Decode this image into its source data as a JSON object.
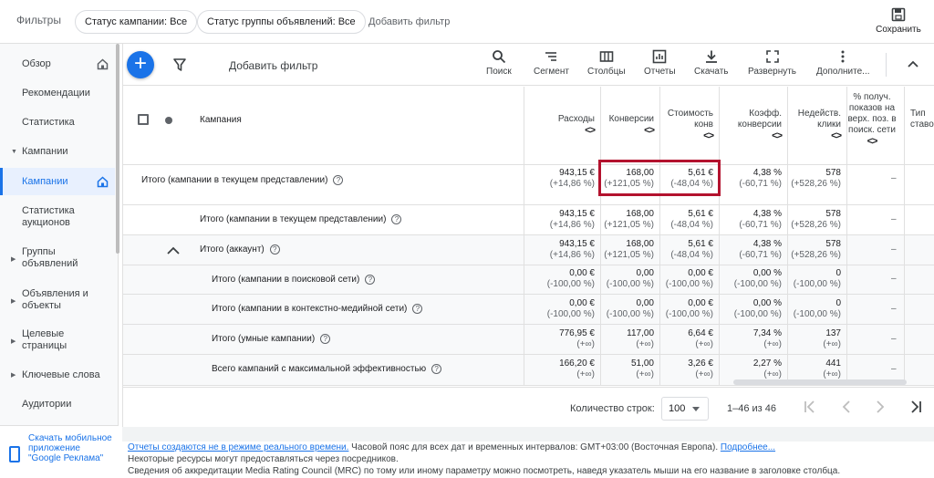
{
  "topbar": {
    "title": "Фильтры",
    "chips": [
      "Статус кампании: Все",
      "Статус группы объявлений: Все"
    ],
    "add_filter": "Добавить фильтр",
    "save_label": "Сохранить"
  },
  "sidebar": {
    "items": [
      {
        "label": "Обзор"
      },
      {
        "label": "Рекомендации"
      },
      {
        "label": "Статистика"
      },
      {
        "label": "Кампании"
      },
      {
        "label": "Кампании"
      },
      {
        "label": "Статистика аукционов"
      },
      {
        "label": "Группы объявлений"
      },
      {
        "label": "Объявления и объекты"
      },
      {
        "label": "Целевые страницы"
      },
      {
        "label": "Ключевые слова"
      },
      {
        "label": "Аудитории"
      }
    ],
    "app_promo": "Скачать мобильное приложение \"Google Реклама\""
  },
  "toolbar": {
    "add_filter": "Добавить фильтр",
    "tools": [
      "Поиск",
      "Сегмент",
      "Столбцы",
      "Отчеты",
      "Скачать",
      "Развернуть",
      "Дополните..."
    ]
  },
  "table": {
    "campaign_header": "Кампания",
    "columns": [
      "Расходы",
      "Конверсии",
      "Стоимость конв",
      "Коэфф. конверсии",
      "Недейств. клики",
      "% получ. показов на верх. поз. в поиск. сети",
      "Тип ставо"
    ],
    "rows": [
      {
        "label": "Итого (кампании в текущем представлении)",
        "values": [
          [
            "943,15 €",
            "(+14,86 %)"
          ],
          [
            "168,00",
            "(+121,05 %)"
          ],
          [
            "5,61 €",
            "(-48,04 %)"
          ],
          [
            "4,38 %",
            "(-60,71 %)"
          ],
          [
            "578",
            "(+528,26 %)"
          ]
        ],
        "dash": "–"
      },
      {
        "label": "Итого (кампании в текущем представлении)",
        "values": [
          [
            "943,15 €",
            "(+14,86 %)"
          ],
          [
            "168,00",
            "(+121,05 %)"
          ],
          [
            "5,61 €",
            "(-48,04 %)"
          ],
          [
            "4,38 %",
            "(-60,71 %)"
          ],
          [
            "578",
            "(+528,26 %)"
          ]
        ],
        "dash": "–"
      },
      {
        "label": "Итого (аккаунт)",
        "values": [
          [
            "943,15 €",
            "(+14,86 %)"
          ],
          [
            "168,00",
            "(+121,05 %)"
          ],
          [
            "5,61 €",
            "(-48,04 %)"
          ],
          [
            "4,38 %",
            "(-60,71 %)"
          ],
          [
            "578",
            "(+528,26 %)"
          ]
        ],
        "dash": "–"
      },
      {
        "label": "Итого (кампании в поисковой сети)",
        "values": [
          [
            "0,00 €",
            "(-100,00 %)"
          ],
          [
            "0,00",
            "(-100,00 %)"
          ],
          [
            "0,00 €",
            "(-100,00 %)"
          ],
          [
            "0,00 %",
            "(-100,00 %)"
          ],
          [
            "0",
            "(-100,00 %)"
          ]
        ],
        "dash": "–"
      },
      {
        "label": "Итого (кампании в контекстно-медийной сети)",
        "values": [
          [
            "0,00 €",
            "(-100,00 %)"
          ],
          [
            "0,00",
            "(-100,00 %)"
          ],
          [
            "0,00 €",
            "(-100,00 %)"
          ],
          [
            "0,00 %",
            "(-100,00 %)"
          ],
          [
            "0",
            "(-100,00 %)"
          ]
        ],
        "dash": "–"
      },
      {
        "label": "Итого (умные кампании)",
        "values": [
          [
            "776,95 €",
            "(+∞)"
          ],
          [
            "117,00",
            "(+∞)"
          ],
          [
            "6,64 €",
            "(+∞)"
          ],
          [
            "7,34 %",
            "(+∞)"
          ],
          [
            "137",
            "(+∞)"
          ]
        ],
        "dash": "–"
      },
      {
        "label": "Всего кампаний с максимальной эффективностью",
        "values": [
          [
            "166,20 €",
            "(+∞)"
          ],
          [
            "51,00",
            "(+∞)"
          ],
          [
            "3,26 €",
            "(+∞)"
          ],
          [
            "2,27 %",
            "(+∞)"
          ],
          [
            "441",
            "(+∞)"
          ]
        ],
        "dash": "–"
      }
    ]
  },
  "pager": {
    "rows_label": "Количество строк:",
    "rows_value": "100",
    "range": "1–46 из 46"
  },
  "footer": {
    "link1": "Отчеты создаются не в режиме реального времени.",
    "line1": " Часовой пояс для всех дат и временных интервалов: GMT+03:00 (Восточная Европа). ",
    "link2": "Подробнее...",
    "line2": "Некоторые ресурсы могут предоставляться через посредников.",
    "line3": "Сведения об аккредитации Media Rating Council (MRC) по тому или иному параметру можно посмотреть, наведя указатель мыши на его название в заголовке столбца."
  },
  "colors": {
    "accent": "#1a73e8",
    "highlight": "#b3122e"
  }
}
